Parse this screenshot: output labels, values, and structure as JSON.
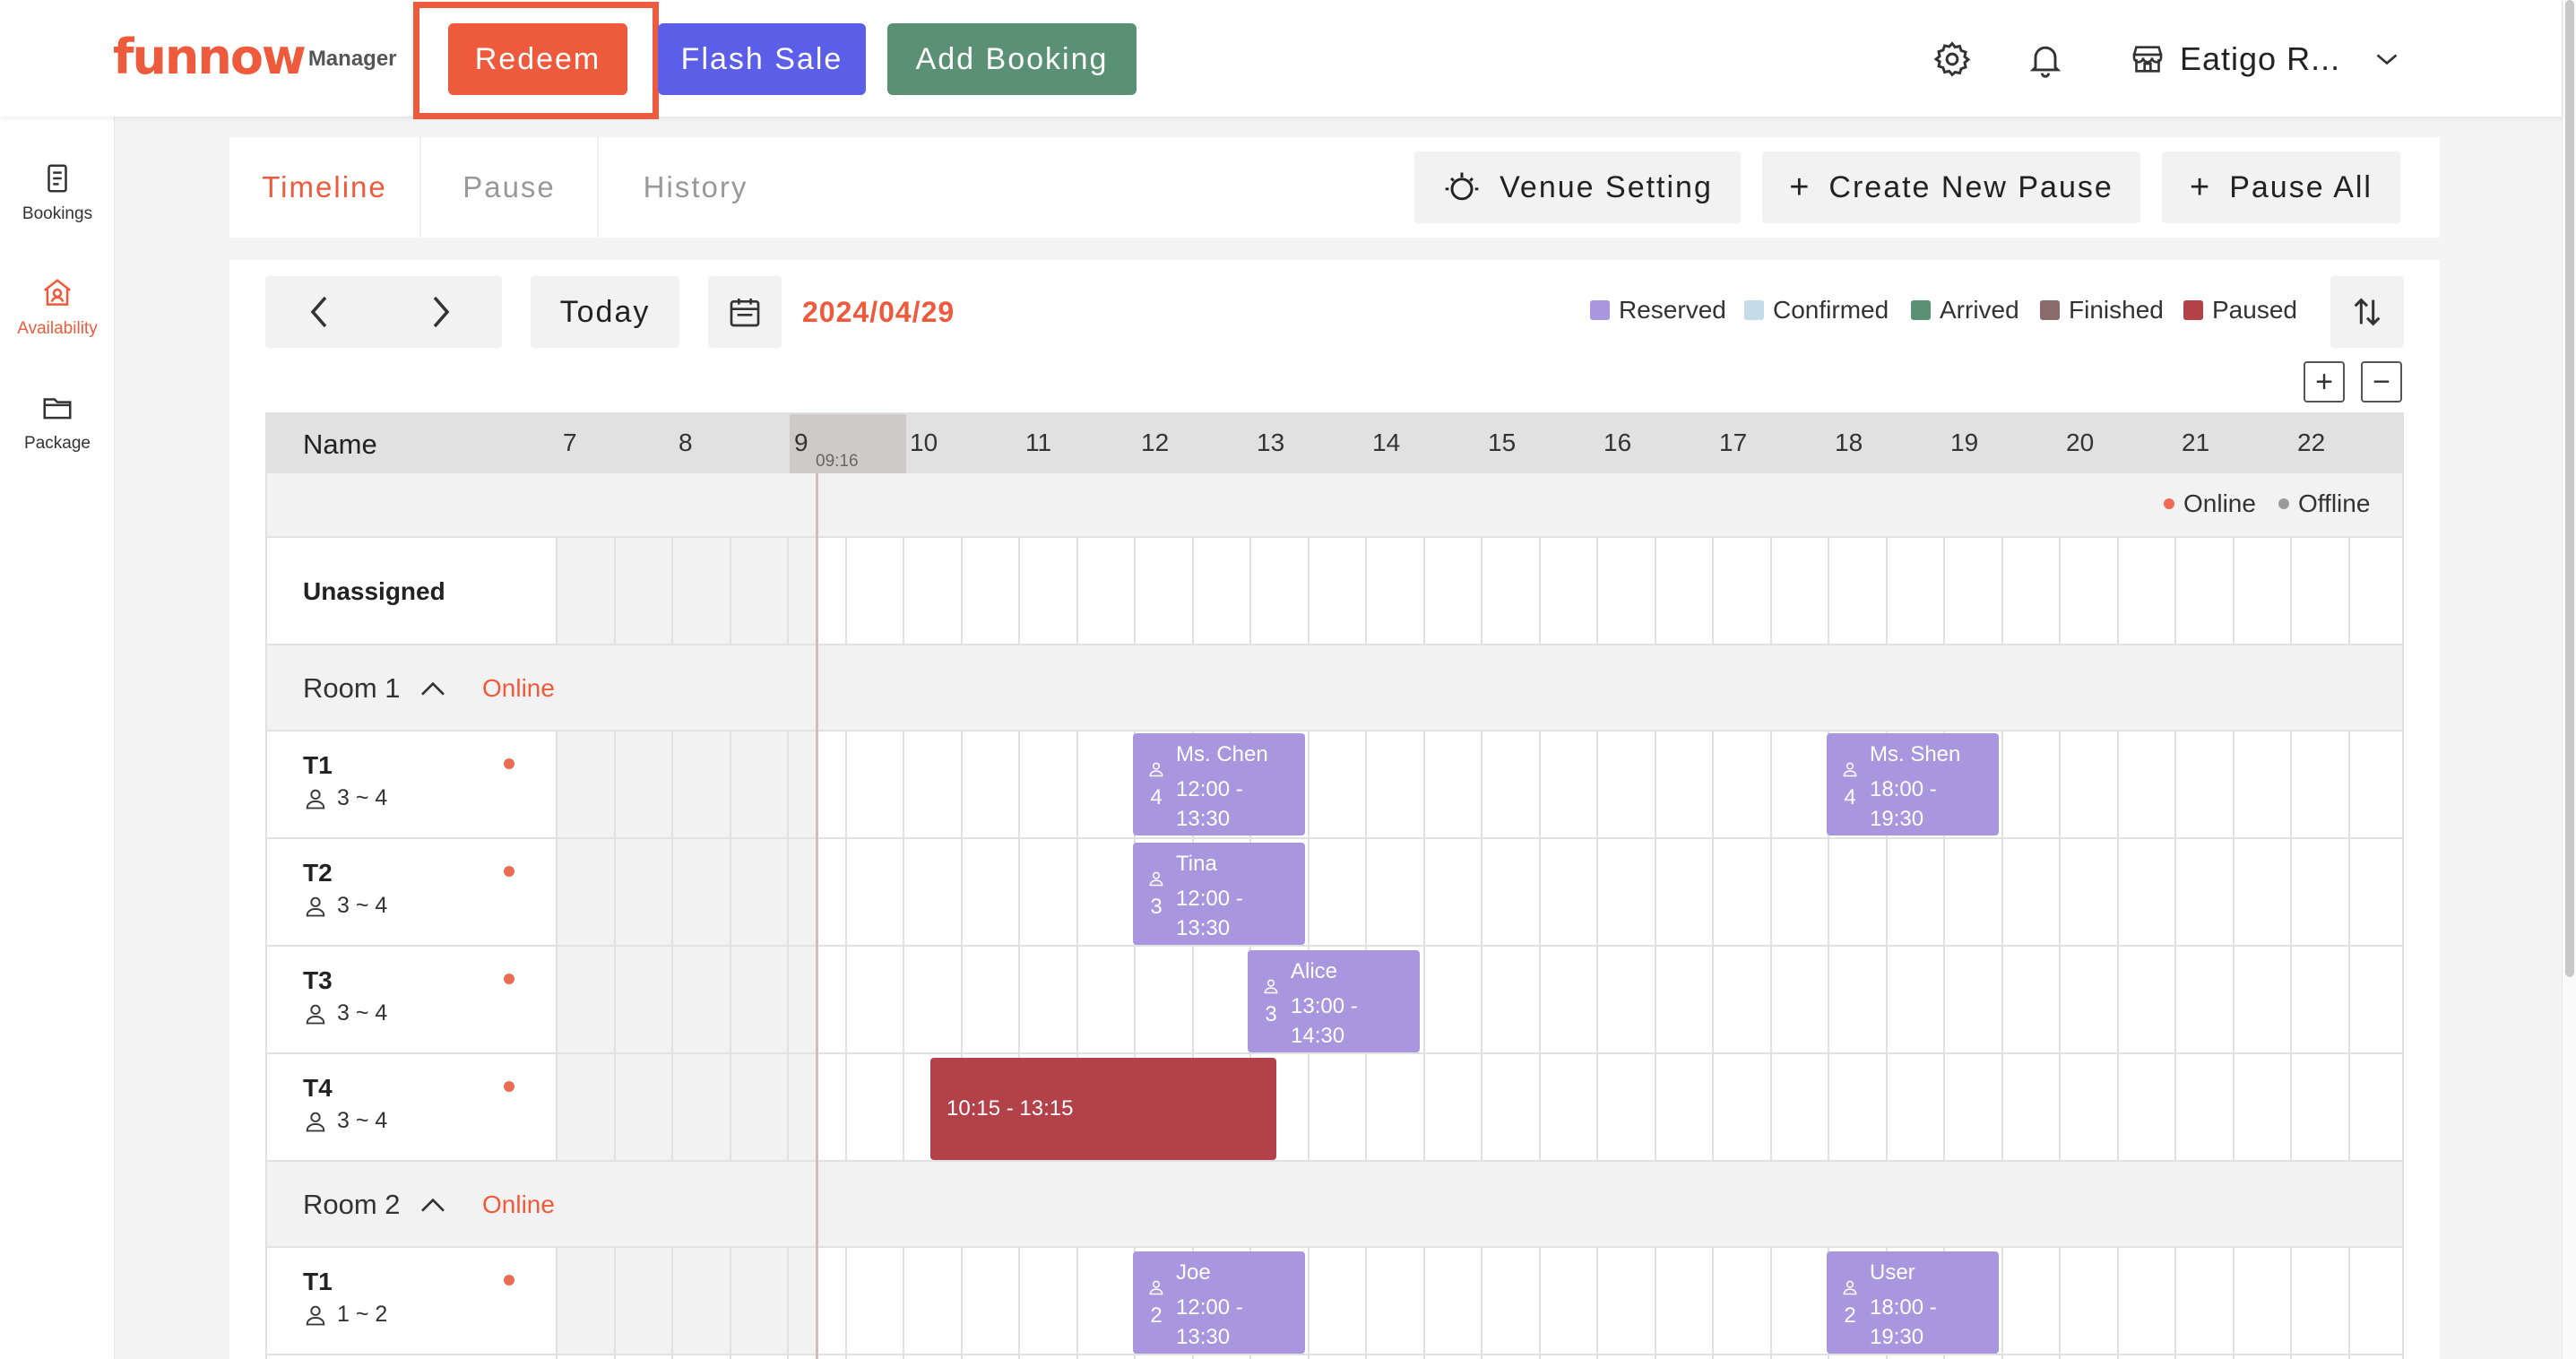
{
  "app": {
    "logo": "funnow",
    "logo_sub": "Manager"
  },
  "top_actions": {
    "redeem": "Redeem",
    "flash_sale": "Flash Sale",
    "add_booking": "Add Booking"
  },
  "venue_selector": "Eatigo R...",
  "sidebar": [
    {
      "label": "Bookings",
      "icon": "document-icon"
    },
    {
      "label": "Availability",
      "icon": "store-person-icon",
      "active": true
    },
    {
      "label": "Package",
      "icon": "folder-icon"
    }
  ],
  "tabs": [
    {
      "label": "Timeline",
      "active": true
    },
    {
      "label": "Pause"
    },
    {
      "label": "History"
    }
  ],
  "tools": {
    "venue_setting": "Venue Setting",
    "create_pause": "Create New Pause",
    "pause_all": "Pause All"
  },
  "controls": {
    "today": "Today",
    "date": "2024/04/29"
  },
  "legend": [
    {
      "label": "Reserved",
      "color": "#a897de"
    },
    {
      "label": "Confirmed",
      "color": "#c4dbe8"
    },
    {
      "label": "Arrived",
      "color": "#5a9073"
    },
    {
      "label": "Finished",
      "color": "#8a6b6b"
    },
    {
      "label": "Paused",
      "color": "#b3414a"
    }
  ],
  "timeline": {
    "name_header": "Name",
    "hours": [
      "7",
      "8",
      "9",
      "10",
      "11",
      "12",
      "13",
      "14",
      "15",
      "16",
      "17",
      "18",
      "19",
      "20",
      "21",
      "22"
    ],
    "now": "09:16",
    "online_label": "Online",
    "offline_label": "Offline",
    "unassigned": "Unassigned",
    "rooms": [
      {
        "name": "Room 1",
        "status": "Online",
        "tables": [
          {
            "name": "T1",
            "capacity": "3 ~ 4"
          },
          {
            "name": "T2",
            "capacity": "3 ~ 4"
          },
          {
            "name": "T3",
            "capacity": "3 ~ 4"
          },
          {
            "name": "T4",
            "capacity": "3 ~ 4"
          }
        ]
      },
      {
        "name": "Room 2",
        "status": "Online",
        "tables": [
          {
            "name": "T1",
            "capacity": "1 ~ 2"
          }
        ]
      }
    ],
    "bookings": [
      {
        "name": "Ms. Chen",
        "people": "4",
        "time": "12:00 -",
        "time_end": "13:30"
      },
      {
        "name": "Ms. Shen",
        "people": "4",
        "time": "18:00 -",
        "time_end": "19:30"
      },
      {
        "name": "Tina",
        "people": "3",
        "time": "12:00 -",
        "time_end": "13:30"
      },
      {
        "name": "Alice",
        "people": "3",
        "time": "13:00 -",
        "time_end": "14:30"
      },
      {
        "name": "Joe",
        "people": "2",
        "time": "12:00 -",
        "time_end": "13:30"
      },
      {
        "name": "User",
        "people": "2",
        "time": "18:00 -",
        "time_end": "19:30"
      }
    ],
    "pause": {
      "time": "10:15 - 13:15"
    }
  }
}
